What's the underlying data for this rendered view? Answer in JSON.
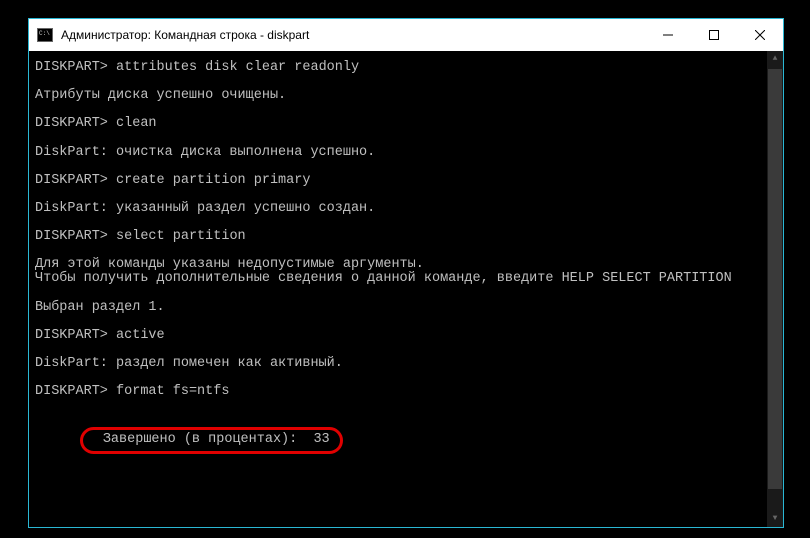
{
  "window": {
    "title": "Администратор: Командная строка - diskpart"
  },
  "terminal": {
    "prompt": "DISKPART>",
    "lines": [
      {
        "type": "cmd",
        "prompt": "DISKPART>",
        "text": "attributes disk clear readonly"
      },
      {
        "type": "out",
        "text": "Атрибуты диска успешно очищены."
      },
      {
        "type": "cmd",
        "prompt": "DISKPART>",
        "text": "clean"
      },
      {
        "type": "out",
        "text": "DiskPart: очистка диска выполнена успешно."
      },
      {
        "type": "cmd",
        "prompt": "DISKPART>",
        "text": "create partition primary"
      },
      {
        "type": "out",
        "text": "DiskPart: указанный раздел успешно создан."
      },
      {
        "type": "cmd",
        "prompt": "DISKPART>",
        "text": "select partition"
      },
      {
        "type": "out",
        "text": "Для этой команды указаны недопустимые аргументы."
      },
      {
        "type": "out",
        "text": "Чтобы получить дополнительные сведения о данной команде, введите HELP SELECT PARTITION"
      },
      {
        "type": "out",
        "text": "Выбран раздел 1."
      },
      {
        "type": "cmd",
        "prompt": "DISKPART>",
        "text": "active"
      },
      {
        "type": "out",
        "text": "DiskPart: раздел помечен как активный."
      },
      {
        "type": "cmd",
        "prompt": "DISKPART>",
        "text": "format fs=ntfs"
      }
    ],
    "progress": {
      "label": "Завершено (в процентах):",
      "value": "33"
    }
  }
}
